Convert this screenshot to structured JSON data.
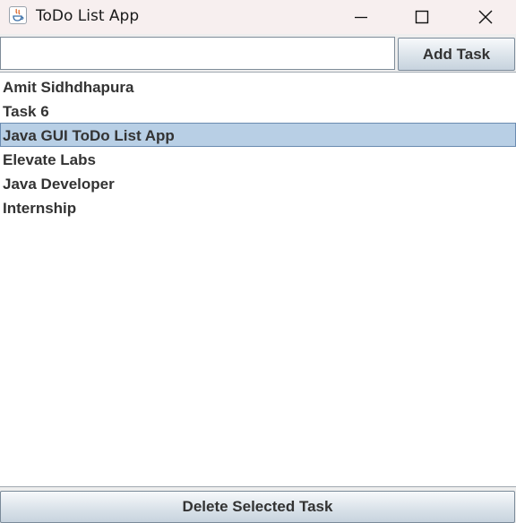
{
  "window": {
    "title": "ToDo List App",
    "icon": "java-cup-icon"
  },
  "controls": {
    "minimize_icon": "minimize-icon",
    "maximize_icon": "maximize-icon",
    "close_icon": "close-icon"
  },
  "input": {
    "value": "",
    "placeholder": ""
  },
  "buttons": {
    "add_label": "Add Task",
    "delete_label": "Delete Selected Task"
  },
  "tasks": [
    {
      "label": "Amit Sidhdhapura",
      "selected": false
    },
    {
      "label": "Task 6",
      "selected": false
    },
    {
      "label": "Java GUI ToDo List App",
      "selected": true
    },
    {
      "label": "Elevate Labs",
      "selected": false
    },
    {
      "label": "Java Developer",
      "selected": false
    },
    {
      "label": "Internship",
      "selected": false
    }
  ],
  "colors": {
    "selection_bg": "#b8cfe5",
    "selection_border": "#6a8bb0",
    "titlebar_bg": "#f7efef"
  }
}
